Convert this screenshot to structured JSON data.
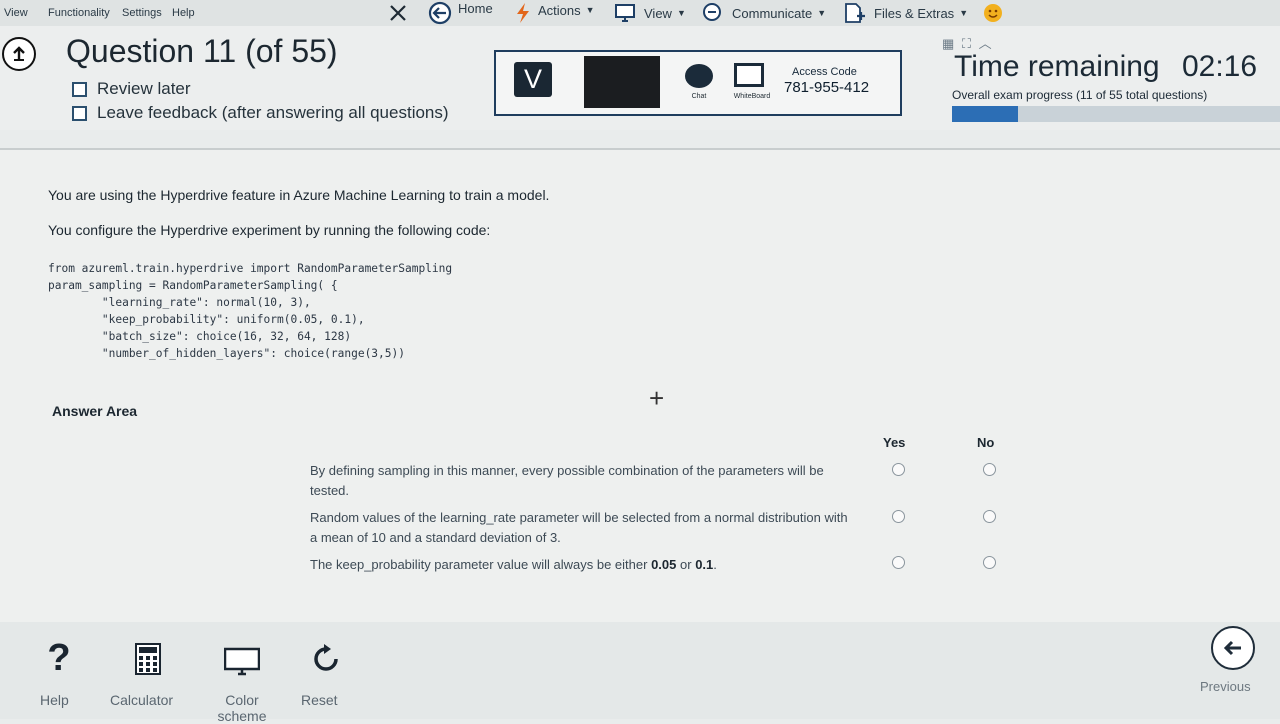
{
  "menu": {
    "items": [
      "View",
      "Functionality",
      "Settings",
      "Help"
    ]
  },
  "toolbar": {
    "home": "Home",
    "actions": "Actions",
    "view": "View",
    "communicate": "Communicate",
    "files": "Files & Extras"
  },
  "question": {
    "title": "Question 11 (of 55)",
    "review_later": "Review later",
    "leave_feedback": "Leave feedback (after answering all questions)"
  },
  "remote": {
    "logo_letter": "V",
    "chat": "Chat",
    "whiteboard": "WhiteBoard",
    "access_code_label": "Access Code",
    "access_code": "781-955-412"
  },
  "timer": {
    "label": "Time remaining",
    "value": "02:16",
    "progress_text": "Overall exam progress (11 of 55 total questions)",
    "progress_fraction": 0.2
  },
  "body": {
    "p1": "You are using the Hyperdrive feature in Azure Machine Learning to train a model.",
    "p2": "You configure the Hyperdrive experiment by running the following code:",
    "code": "from azureml.train.hyperdrive import RandomParameterSampling\nparam_sampling = RandomParameterSampling( {\n        \"learning_rate\": normal(10, 3),\n        \"keep_probability\": uniform(0.05, 0.1),\n        \"batch_size\": choice(16, 32, 64, 128)\n        \"number_of_hidden_layers\": choice(range(3,5))"
  },
  "answer": {
    "title": "Answer Area",
    "yes": "Yes",
    "no": "No",
    "statements": [
      {
        "text": "By defining sampling in this manner, every possible combination of the parameters will be tested."
      },
      {
        "text": "Random values of the learning_rate parameter will be selected from a normal distribution with a mean of 10 and a standard deviation of 3."
      },
      {
        "prefix": "The keep_probability parameter value will always be either ",
        "v1": "0.05",
        "mid": " or ",
        "v2": "0.1",
        "suffix": "."
      }
    ]
  },
  "tools": {
    "help": "Help",
    "calculator": "Calculator",
    "color": "Color scheme",
    "reset": "Reset",
    "previous": "Previous"
  }
}
